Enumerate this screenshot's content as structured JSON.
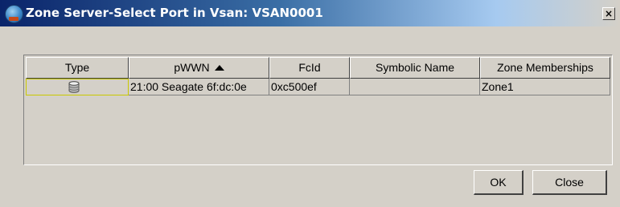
{
  "window": {
    "title": "Zone Server-Select Port in Vsan: VSAN0001",
    "close_label": "×"
  },
  "table": {
    "headers": {
      "type": "Type",
      "pwwn": "pWWN",
      "fcid": "FcId",
      "symbolic": "Symbolic Name",
      "zone": "Zone Memberships"
    },
    "sort_column": "pWWN",
    "sort_direction": "ascending",
    "rows": [
      {
        "type_icon": "disk-icon",
        "pwwn": "21:00 Seagate 6f:dc:0e",
        "fcid": "0xc500ef",
        "symbolic": "",
        "zone": "Zone1"
      }
    ]
  },
  "buttons": {
    "ok": "OK",
    "close": "Close"
  },
  "colors": {
    "title_start": "#0a246a",
    "title_end": "#a6caf0",
    "selection_border": "#c8c800",
    "face": "#d4d0c8"
  }
}
